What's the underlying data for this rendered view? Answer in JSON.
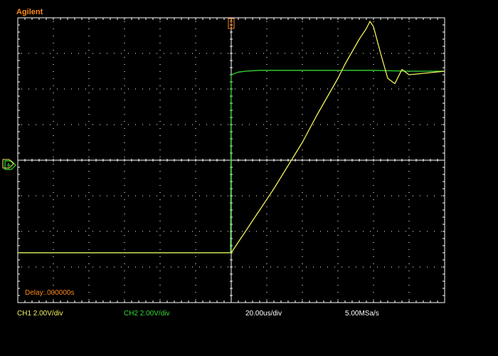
{
  "brand": "Agilent",
  "delay_label": "Delay:.000000s",
  "status": {
    "ch1": "CH1 2.00V/div",
    "ch2": "CH2 2.00V/div",
    "timebase": "20.00us/div",
    "sample_rate": "5.00MSa/s"
  },
  "colors": {
    "background": "#000000",
    "grid": "#ffffff",
    "ch1": "#f2f25a",
    "ch2": "#36d836",
    "brand": "#ff8a1a",
    "delay": "#ff8a1a",
    "trigger_marker": "#ff8a1a"
  },
  "chart_data": {
    "type": "line",
    "title": "",
    "xlabel": "",
    "ylabel": "",
    "x_units": "us",
    "y_units": "V",
    "xlim": [
      -60,
      60
    ],
    "ylim": [
      -8,
      8
    ],
    "grid": true,
    "series": [
      {
        "name": "CH1",
        "x": [
          -60,
          -20,
          0,
          4,
          8,
          12,
          16,
          20,
          24,
          26,
          28,
          30,
          31,
          32,
          34,
          36,
          38,
          39,
          40,
          42,
          44,
          46,
          48,
          50,
          60
        ],
        "y": [
          -5.2,
          -5.2,
          -5.2,
          -4.0,
          -2.8,
          -1.6,
          -0.3,
          1.0,
          2.5,
          3.2,
          3.9,
          4.6,
          5.0,
          5.4,
          6.1,
          6.8,
          7.4,
          7.8,
          7.5,
          6.0,
          4.6,
          4.3,
          5.1,
          4.8,
          5.0
        ],
        "color": "#f2f25a"
      },
      {
        "name": "CH2",
        "x": [
          -60,
          -20,
          -0.2,
          0,
          0.6,
          2,
          4,
          8,
          12,
          20,
          30,
          40,
          50,
          60
        ],
        "y": [
          -5.2,
          -5.2,
          -5.2,
          4.8,
          4.85,
          4.95,
          5.0,
          5.05,
          5.05,
          5.05,
          5.05,
          5.05,
          5.0,
          5.0
        ],
        "color": "#36d836"
      }
    ]
  }
}
